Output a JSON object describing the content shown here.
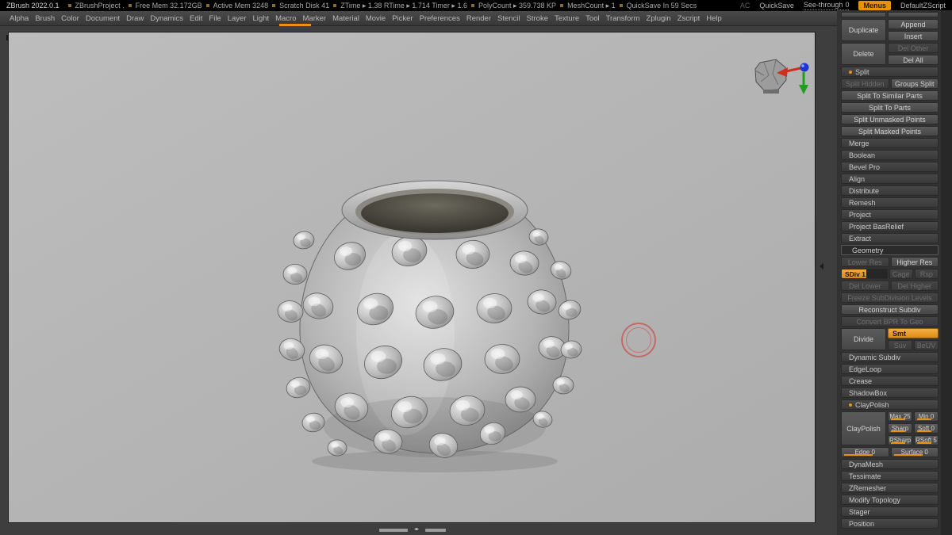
{
  "accent": "#e8920c",
  "titlebar": {
    "app_title": "ZBrush 2022.0.1",
    "stats": [
      "ZBrushProject .",
      "Free Mem 32.172GB",
      "Active Mem 3248",
      "Scratch Disk 41",
      "ZTime ▸ 1.38  RTime ▸ 1.714  Timer ▸ 1.6",
      "PolyCount ▸ 359.738 KP",
      "MeshCount ▸ 1",
      "QuickSave In 59 Secs"
    ],
    "ac": "AC",
    "quicksave": "QuickSave",
    "see_through_label": "See-through",
    "see_through_value": "0",
    "menus": "Menus",
    "zscript": "DefaultZScript"
  },
  "menubar": {
    "items": [
      "Alpha",
      "Brush",
      "Color",
      "Document",
      "Draw",
      "Dynamics",
      "Edit",
      "File",
      "Layer",
      "Light",
      "Macro",
      "Marker",
      "Material",
      "Movie",
      "Picker",
      "Preferences",
      "Render",
      "Stencil",
      "Stroke",
      "Texture",
      "Tool",
      "Transform",
      "Zplugin",
      "Zscript",
      "Help"
    ]
  },
  "tool_panel": {
    "blocks": [
      {
        "type": "sliver"
      },
      {
        "type": "pair",
        "left": {
          "label": "Duplicate"
        },
        "right_rows": [
          [
            {
              "label": "Append"
            }
          ],
          [
            {
              "label": "Insert"
            }
          ]
        ]
      },
      {
        "type": "pair",
        "left": {
          "label": "Delete"
        },
        "right_rows": [
          [
            {
              "label": "Del Other",
              "disabled": true
            }
          ],
          [
            {
              "label": "Del All"
            }
          ]
        ]
      },
      {
        "type": "header",
        "label": "Split",
        "open": true
      },
      {
        "type": "row",
        "cells": [
          {
            "label": "Split Hidden",
            "disabled": true
          },
          {
            "label": "Groups Split"
          }
        ]
      },
      {
        "type": "row",
        "cells": [
          {
            "label": "Split To Similar Parts"
          }
        ]
      },
      {
        "type": "row",
        "cells": [
          {
            "label": "Split To Parts"
          }
        ]
      },
      {
        "type": "row",
        "cells": [
          {
            "label": "Split Unmasked Points"
          }
        ]
      },
      {
        "type": "row",
        "cells": [
          {
            "label": "Split Masked Points"
          }
        ]
      },
      {
        "type": "header",
        "label": "Merge"
      },
      {
        "type": "header",
        "label": "Boolean"
      },
      {
        "type": "header",
        "label": "Bevel Pro"
      },
      {
        "type": "header",
        "label": "Align"
      },
      {
        "type": "header",
        "label": "Distribute"
      },
      {
        "type": "header",
        "label": "Remesh"
      },
      {
        "type": "header",
        "label": "Project"
      },
      {
        "type": "header",
        "label": "Project BasRelief"
      },
      {
        "type": "header",
        "label": "Extract"
      },
      {
        "type": "palette_title",
        "label": "Geometry"
      },
      {
        "type": "row",
        "cells": [
          {
            "label": "Lower Res",
            "disabled": true
          },
          {
            "label": "Higher Res"
          }
        ]
      },
      {
        "type": "row",
        "cells": [
          {
            "label": "SDiv 1",
            "slider": true,
            "fill": 55,
            "w": 2
          },
          {
            "label": "Cage",
            "disabled": true
          },
          {
            "label": "Rsp",
            "disabled": true
          }
        ]
      },
      {
        "type": "row",
        "cells": [
          {
            "label": "Del Lower",
            "disabled": true
          },
          {
            "label": "Del Higher",
            "disabled": true
          }
        ]
      },
      {
        "type": "row",
        "cells": [
          {
            "label": "Freeze SubDivision Levels",
            "disabled": true
          }
        ]
      },
      {
        "type": "row",
        "cells": [
          {
            "label": "Reconstruct Subdiv"
          }
        ]
      },
      {
        "type": "row",
        "cells": [
          {
            "label": "Convert BPR To Geo",
            "disabled": true
          }
        ]
      },
      {
        "type": "pair",
        "left": {
          "label": "Divide"
        },
        "right_rows": [
          [
            {
              "label": "Smt",
              "orange": true
            }
          ],
          [
            {
              "label": "Suv",
              "disabled": true
            },
            {
              "label": "BeUV",
              "disabled": true
            }
          ]
        ]
      },
      {
        "type": "header",
        "label": "Dynamic Subdiv"
      },
      {
        "type": "header",
        "label": "EdgeLoop"
      },
      {
        "type": "header",
        "label": "Crease"
      },
      {
        "type": "header",
        "label": "ShadowBox"
      },
      {
        "type": "header",
        "label": "ClayPolish",
        "open": true
      },
      {
        "type": "pair",
        "left": {
          "label": "ClayPolish"
        },
        "right_rows": [
          [
            {
              "label": "Max 25",
              "mslider": true
            },
            {
              "label": "Min 0",
              "mslider": true
            }
          ],
          [
            {
              "label": "Sharp",
              "mslider": true
            },
            {
              "label": "Soft 0",
              "mslider": true
            }
          ],
          [
            {
              "label": "RSharp",
              "mslider": true
            },
            {
              "label": "RSoft 5",
              "mslider": true
            }
          ]
        ]
      },
      {
        "type": "row",
        "cells": [
          {
            "label": "Edge 0",
            "mslider": true
          },
          {
            "label": "Surface 0",
            "mslider": true
          }
        ]
      },
      {
        "type": "header",
        "label": "DynaMesh"
      },
      {
        "type": "header",
        "label": "Tessimate"
      },
      {
        "type": "header",
        "label": "ZRemesher"
      },
      {
        "type": "header",
        "label": "Modify Topology"
      },
      {
        "type": "header",
        "label": "Stager"
      },
      {
        "type": "header",
        "label": "Position"
      }
    ]
  }
}
